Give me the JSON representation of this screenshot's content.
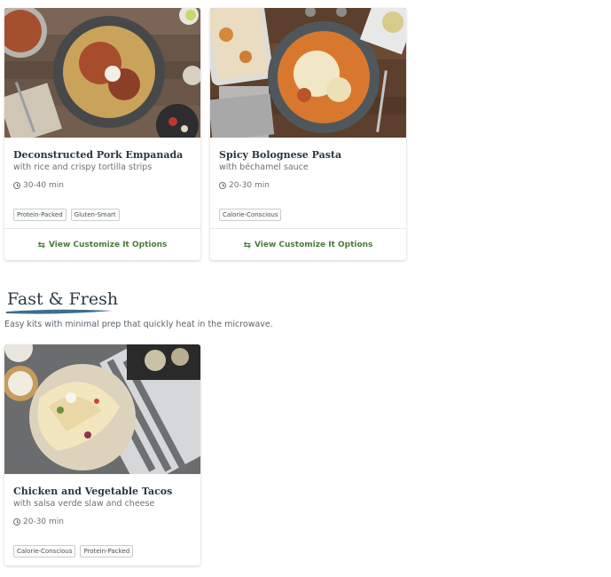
{
  "cards": [
    {
      "title": "Deconstructed Pork Empanada",
      "subtitle": "with rice and crispy tortilla strips",
      "time": "30-40 min",
      "tags": [
        "Protein-Packed",
        "Gluten-Smart"
      ],
      "footer": "View Customize It Options"
    },
    {
      "title": "Spicy Bolognese Pasta",
      "subtitle": "with béchamel sauce",
      "time": "20-30 min",
      "tags": [
        "Calorie-Conscious"
      ],
      "footer": "View Customize It Options"
    }
  ],
  "section": {
    "title": "Fast & Fresh",
    "description": "Easy kits with minimal prep that quickly heat in the microwave.",
    "underline_color": "#3d6f8e"
  },
  "section_cards": [
    {
      "title": "Chicken and Vegetable Tacos",
      "subtitle": "with salsa verde slaw and cheese",
      "time": "20-30 min",
      "tags": [
        "Calorie-Conscious",
        "Protein-Packed"
      ]
    }
  ],
  "colors": {
    "link": "#4c7a3b",
    "heading": "#2e3a43"
  },
  "icons": {
    "time": "clock-icon",
    "customize": "swap-arrows-icon"
  }
}
